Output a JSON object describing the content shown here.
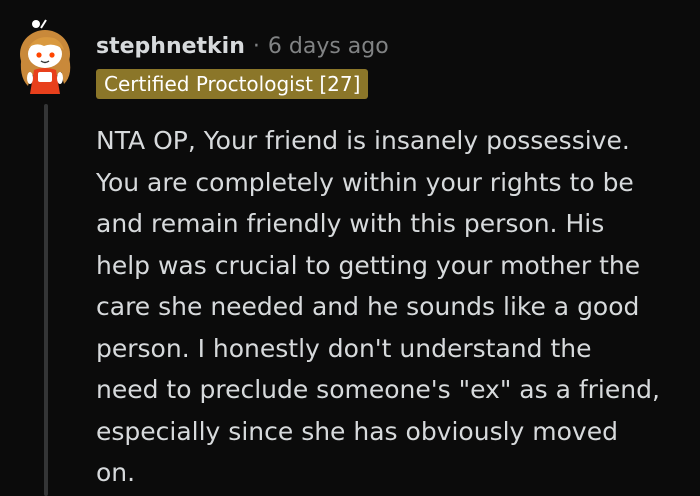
{
  "comment": {
    "username": "stephnetkin",
    "separator": "·",
    "timestamp": "6 days ago",
    "flair": "Certified Proctologist [27]",
    "avatar_icon": "snoo-avatar-icon",
    "body_lines": [
      "NTA OP, Your friend is insanely possessive.",
      "You are completely within your rights to be",
      "and remain friendly with this person. His",
      "help was crucial to getting your mother the",
      "care she needed and he sounds like a good",
      "person. I honestly don't understand the",
      "need to preclude someone's \"ex\" as a friend,",
      "especially since she has obviously moved",
      "on."
    ]
  },
  "colors": {
    "background": "#0b0b0b",
    "text": "#d7dadc",
    "muted": "#818384",
    "flair_bg": "#8b7629",
    "flair_text": "#ffffff",
    "thread_line": "#343536"
  }
}
